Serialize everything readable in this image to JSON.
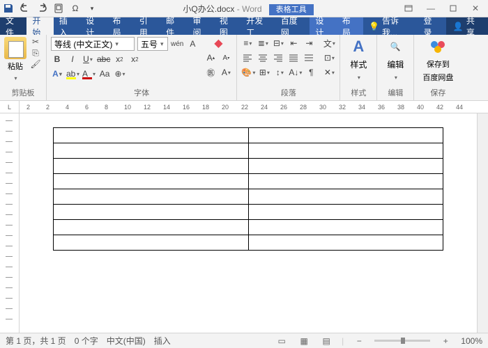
{
  "title": {
    "doc": "小Q办公.docx",
    "app": "Word",
    "table_tools": "表格工具"
  },
  "menu": {
    "file": "文件",
    "home": "开始",
    "insert": "插入",
    "design": "设计",
    "layout": "布局",
    "ref": "引用",
    "mail": "邮件",
    "review": "审阅",
    "view": "视图",
    "dev": "开发工",
    "baidu": "百度网",
    "tdesign": "设计",
    "tlayout": "布局",
    "tellme": "告诉我...",
    "login": "登录",
    "share": "共享"
  },
  "ribbon": {
    "clipboard": {
      "label": "剪贴板",
      "paste": "粘贴"
    },
    "font": {
      "label": "字体",
      "name": "等线 (中文正文)",
      "size": "五号",
      "wen": "wén"
    },
    "para": {
      "label": "段落"
    },
    "styles": {
      "label": "样式",
      "btn": "样式"
    },
    "edit": {
      "label": "编辑",
      "btn": "编辑"
    },
    "save": {
      "label": "保存",
      "btn": "保存到",
      "btn2": "百度网盘"
    }
  },
  "ruler_ticks": [
    "2",
    "2",
    "4",
    "6",
    "8",
    "10",
    "12",
    "14",
    "16",
    "18",
    "20",
    "22",
    "24",
    "26",
    "28",
    "30",
    "32",
    "34",
    "36",
    "38",
    "40",
    "42",
    "44"
  ],
  "table": {
    "rows": 8,
    "cols": 2
  },
  "status": {
    "page": "第 1 页，共 1 页",
    "words": "0 个字",
    "lang": "中文(中国)",
    "mode": "插入",
    "zoom": "100%"
  }
}
